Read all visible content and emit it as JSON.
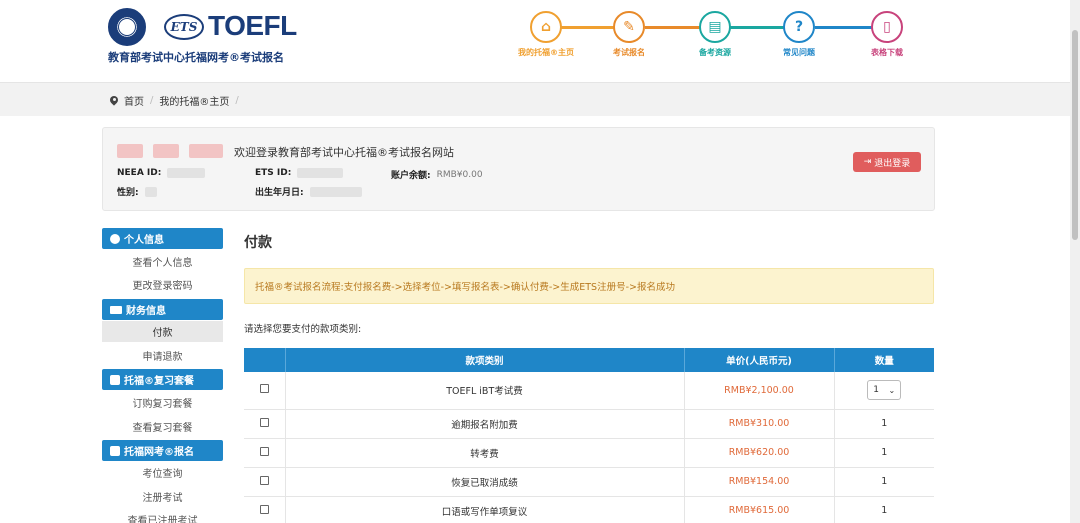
{
  "header": {
    "logo_ets": "ETS",
    "logo_toefl": "TOEFL",
    "site_title": "教育部考试中心托福网考®考试报名"
  },
  "steps": [
    {
      "label": "我的托福®主页",
      "glyph": "⌂",
      "color": "#f0a030"
    },
    {
      "label": "考试报名",
      "glyph": "✎",
      "color": "#e88a2a"
    },
    {
      "label": "备考资源",
      "glyph": "▤",
      "color": "#1aa7a0"
    },
    {
      "label": "常见问题",
      "glyph": "?",
      "color": "#1f86c8"
    },
    {
      "label": "表格下载",
      "glyph": "▯",
      "color": "#c8437c"
    }
  ],
  "breadcrumb": {
    "home": "首页",
    "current": "我的托福®主页"
  },
  "welcome": {
    "title": "欢迎登录教育部考试中心托福®考试报名网站",
    "neea_label": "NEEA ID:",
    "ets_label": "ETS ID:",
    "balance_label": "账户余额:",
    "balance_value": "RMB¥0.00",
    "gender_label": "性别:",
    "birth_label": "出生年月日:",
    "logout": "退出登录"
  },
  "sidebar": {
    "personal": "个人信息",
    "view_personal": "查看个人信息",
    "change_password": "更改登录密码",
    "finance": "财务信息",
    "payment": "付款",
    "refund": "申请退款",
    "review_pack": "托福®复习套餐",
    "buy_pack": "订购复习套餐",
    "view_pack": "查看复习套餐",
    "register": "托福网考®报名",
    "seat_query": "考位查询",
    "register_exam": "注册考试",
    "view_registered": "查看已注册考试"
  },
  "main": {
    "title": "付款",
    "notice": "托福®考试报名流程:支付报名费->选择考位->填写报名表->确认付费->生成ETS注册号->报名成功",
    "prompt": "请选择您要支付的款项类别:",
    "table": {
      "headers": [
        "款项类别",
        "单价(人民币元)",
        "数量"
      ],
      "rows": [
        {
          "item": "TOEFL iBT考试费",
          "price": "RMB¥2,100.00",
          "qty": "1"
        },
        {
          "item": "逾期报名附加费",
          "price": "RMB¥310.00",
          "qty": "1"
        },
        {
          "item": "转考费",
          "price": "RMB¥620.00",
          "qty": "1"
        },
        {
          "item": "恢复已取消成绩",
          "price": "RMB¥154.00",
          "qty": "1"
        },
        {
          "item": "口语或写作单项复议",
          "price": "RMB¥615.00",
          "qty": "1"
        }
      ]
    }
  }
}
